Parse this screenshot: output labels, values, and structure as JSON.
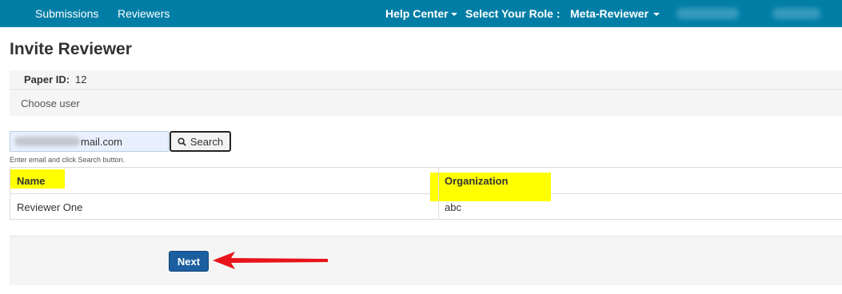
{
  "nav": {
    "submissions": "Submissions",
    "reviewers": "Reviewers",
    "help_center": "Help Center",
    "role_label": "Select Your Role :",
    "role_value": "Meta-Reviewer"
  },
  "page": {
    "title": "Invite Reviewer"
  },
  "paper": {
    "label": "Paper ID:",
    "value": "12"
  },
  "choose_user": "Choose user",
  "search": {
    "input_value_visible": "mail.com",
    "button_label": "Search",
    "hint": "Enter email and click Search button."
  },
  "table": {
    "headers": [
      "Name",
      "Organization"
    ],
    "rows": [
      [
        "Reviewer One",
        "abc"
      ]
    ]
  },
  "actions": {
    "next_label": "Next"
  },
  "colors": {
    "nav_bg": "#027ea6",
    "highlight": "#ffff00",
    "next_button": "#1c5fa0",
    "annotation_arrow": "#e8141a"
  }
}
